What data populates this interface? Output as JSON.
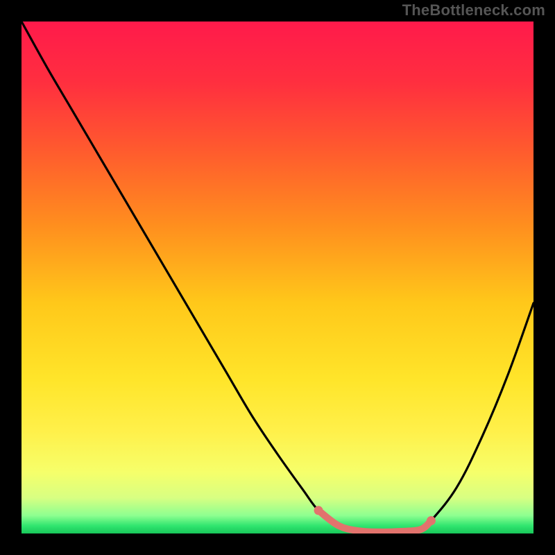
{
  "watermark": "TheBottleneck.com",
  "colors": {
    "background": "#000000",
    "gradient_stops": [
      {
        "offset": 0.0,
        "color": "#ff1a4b"
      },
      {
        "offset": 0.12,
        "color": "#ff2f3f"
      },
      {
        "offset": 0.25,
        "color": "#ff5a2e"
      },
      {
        "offset": 0.4,
        "color": "#ff8f1e"
      },
      {
        "offset": 0.55,
        "color": "#ffc81a"
      },
      {
        "offset": 0.7,
        "color": "#ffe52a"
      },
      {
        "offset": 0.8,
        "color": "#fff04a"
      },
      {
        "offset": 0.88,
        "color": "#f6ff6a"
      },
      {
        "offset": 0.93,
        "color": "#d8ff82"
      },
      {
        "offset": 0.965,
        "color": "#8dff90"
      },
      {
        "offset": 0.985,
        "color": "#30e56f"
      },
      {
        "offset": 1.0,
        "color": "#18c75a"
      }
    ],
    "curve": "#000000",
    "highlight": "#e2736d"
  },
  "chart_data": {
    "type": "line",
    "title": "",
    "xlabel": "",
    "ylabel": "",
    "xlim": [
      0,
      100
    ],
    "ylim": [
      0,
      100
    ],
    "series": [
      {
        "name": "bottleneck-curve",
        "x": [
          0,
          5,
          10,
          15,
          20,
          25,
          30,
          35,
          40,
          45,
          50,
          55,
          58,
          62,
          66,
          70,
          74,
          78,
          80,
          85,
          90,
          95,
          100
        ],
        "y": [
          100,
          91,
          82.5,
          74,
          65.5,
          57,
          48.5,
          40,
          31.5,
          23,
          15.5,
          8.5,
          4.5,
          1.5,
          0.5,
          0.3,
          0.4,
          0.8,
          2.5,
          9,
          19,
          31,
          45
        ]
      }
    ],
    "highlight_segment": {
      "name": "flat-bottom",
      "x_start": 58,
      "x_end": 80,
      "endpoints": [
        {
          "x": 58,
          "y": 4.5
        },
        {
          "x": 80,
          "y": 2.5
        }
      ],
      "path_x": [
        58,
        62,
        66,
        70,
        74,
        78,
        80
      ],
      "path_y": [
        4.5,
        1.5,
        0.5,
        0.3,
        0.4,
        0.8,
        2.5
      ]
    }
  }
}
